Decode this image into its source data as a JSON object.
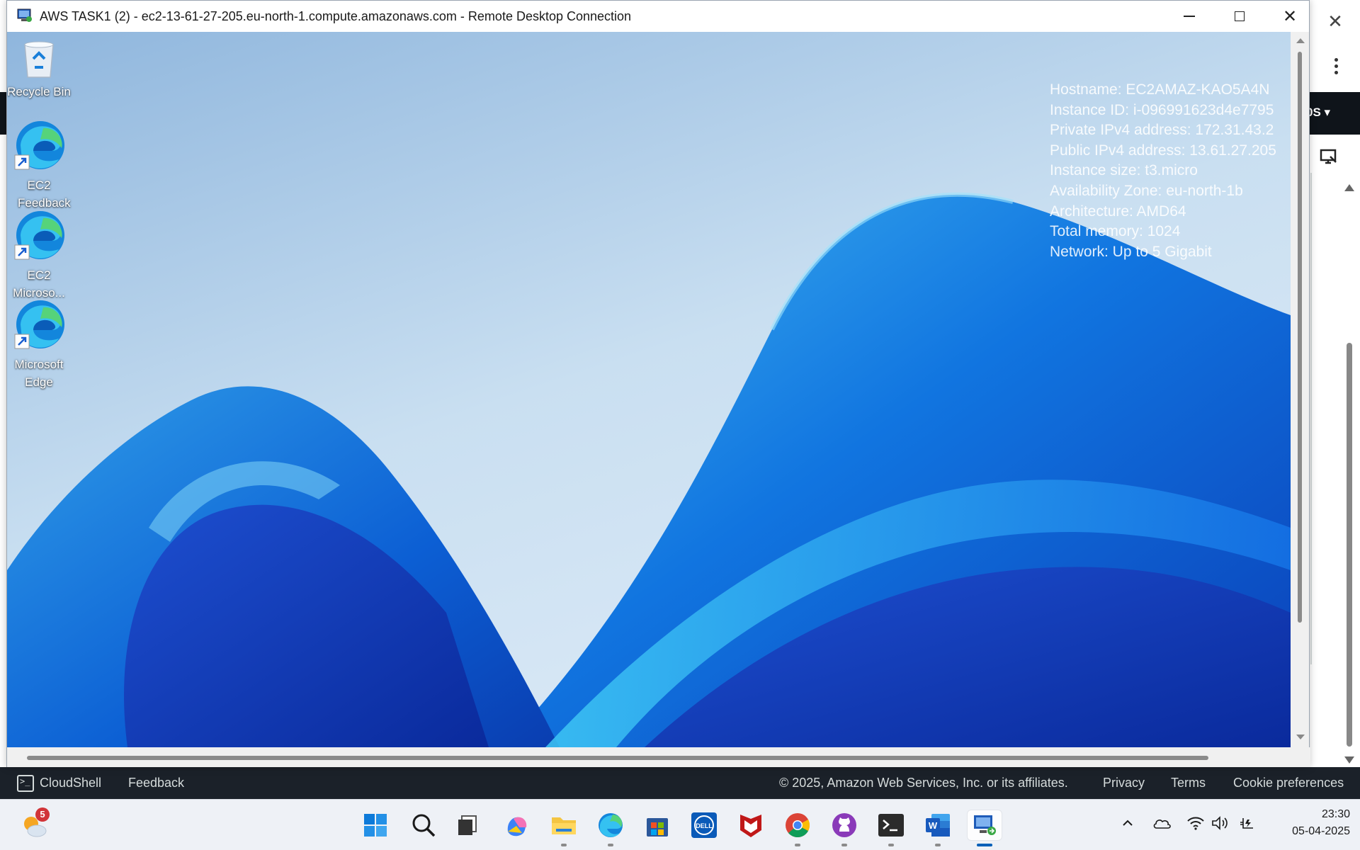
{
  "rdp_window": {
    "title": "AWS TASK1 (2) - ec2-13-61-27-205.eu-north-1.compute.amazonaws.com - Remote Desktop Connection"
  },
  "desktop": {
    "icons": [
      {
        "label": "Recycle Bin",
        "icon": "recycle-bin-icon"
      },
      {
        "label": "EC2 Feedback",
        "icon": "edge-shortcut-icon"
      },
      {
        "label": "EC2 Microso...",
        "icon": "edge-shortcut-icon"
      },
      {
        "label": "Microsoft Edge",
        "icon": "edge-shortcut-icon"
      }
    ]
  },
  "instance_info": {
    "hostname": "Hostname: EC2AMAZ-KAO5A4N",
    "instance_id": "Instance ID: i-096991623d4e7795",
    "private_ip": "Private IPv4 address: 172.31.43.2",
    "public_ip": "Public IPv4 address: 13.61.27.205",
    "instance_size": "Instance size: t3.micro",
    "availability_zone": "Availability Zone: eu-north-1b",
    "architecture": "Architecture: AMD64",
    "total_memory": "Total memory: 1024",
    "network": "Network: Up to 5 Gigabit"
  },
  "host_browser": {
    "navbar_text": "0S ▾"
  },
  "aws_footer": {
    "cloudshell": "CloudShell",
    "feedback": "Feedback",
    "copyright": "© 2025, Amazon Web Services, Inc. or its affiliates.",
    "privacy": "Privacy",
    "terms": "Terms",
    "cookie": "Cookie preferences"
  },
  "taskbar": {
    "weather_badge": "5",
    "apps": [
      "start-icon",
      "search-icon",
      "task-view-icon",
      "copilot-icon",
      "file-explorer-icon",
      "edge-icon",
      "store-icon",
      "dell-icon",
      "mcafee-icon",
      "chrome-icon",
      "github-desktop-icon",
      "terminal-icon",
      "word-icon",
      "remote-desktop-icon"
    ],
    "time": "23:30",
    "date": "05-04-2025"
  },
  "colors": {
    "aws_footer_bg": "#1b2129",
    "aws_navbar_bg": "#0f141a",
    "taskbar_bg": "#eef1f6",
    "wallpaper_base": "#a9c8e4",
    "wave_blue": "#0a5fd8"
  }
}
